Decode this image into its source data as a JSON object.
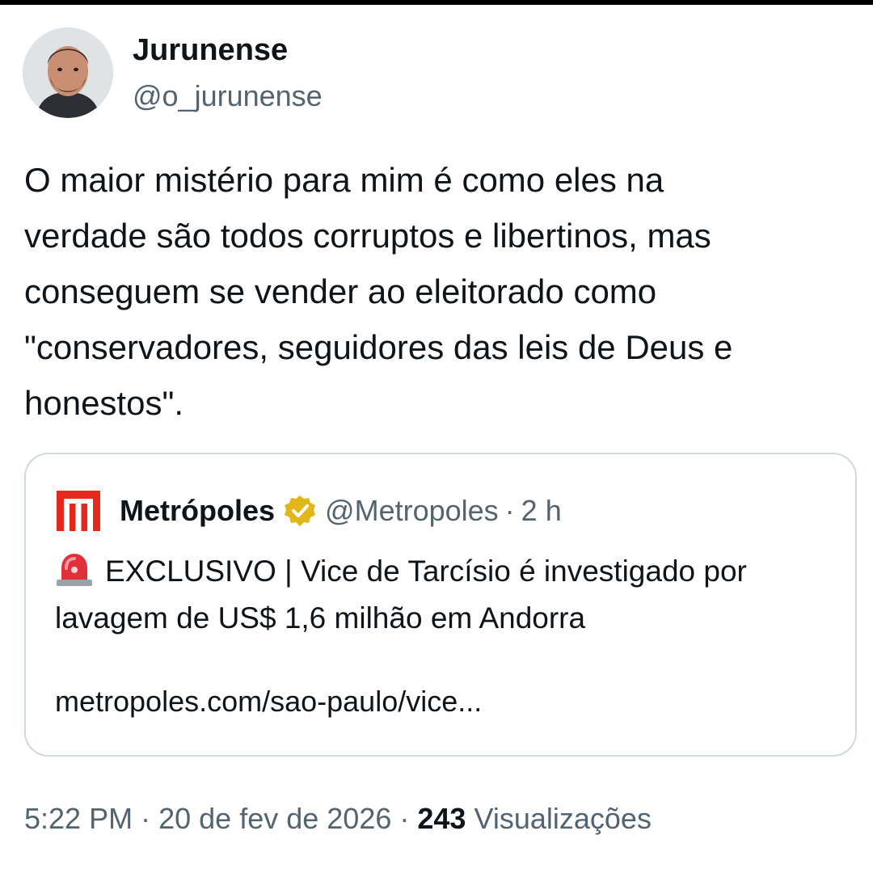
{
  "author": {
    "display_name": "Jurunense",
    "handle": "@o_jurunense",
    "avatar_icon": "person-avatar-icon"
  },
  "tweet": {
    "text": "O maior mistério para mim é como eles na\nverdade são todos corruptos e libertinos, mas\nconseguem se vender ao eleitorado como\n\"conservadores, seguidores das leis de Deus e\nhonestos\"."
  },
  "quote": {
    "logo_icon": "metropoles-logo-icon",
    "name": "Metrópoles",
    "verified_icon": "gold-verified-badge-icon",
    "handle": "@Metropoles",
    "separator": "·",
    "time": "2 h",
    "siren_icon": "police-siren-emoji-icon",
    "text": "EXCLUSIVO | Vice de Tarcísio é investigado por lavagem de US$ 1,6 milhão em Andorra",
    "link": "metropoles.com/sao-paulo/vice..."
  },
  "meta": {
    "time": "5:22 PM",
    "separator": "·",
    "date": "20 de fev de 2026",
    "views_count": "243",
    "views_label": "Visualizações"
  },
  "colors": {
    "text_primary": "#0f1419",
    "text_secondary": "#536471",
    "border": "#cfd9de",
    "metropoles_red": "#e5271e",
    "verified_gold": "#e2b719"
  }
}
